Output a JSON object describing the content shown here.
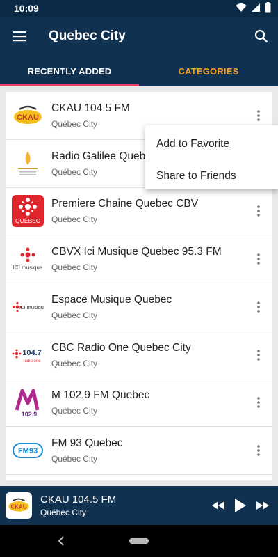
{
  "status_bar": {
    "time": "10:09",
    "icons": [
      "wifi-icon",
      "signal-icon",
      "battery-icon"
    ]
  },
  "app_bar": {
    "title": "Quebec City",
    "menu_icon": "hamburger-menu-icon",
    "search_icon": "search-icon"
  },
  "tabs": [
    {
      "label": "RECENTLY ADDED",
      "active": true
    },
    {
      "label": "CATEGORIES",
      "active": false
    }
  ],
  "stations": [
    {
      "name": "CKAU 104.5 FM",
      "city": "Québec City"
    },
    {
      "name": "Radio Galilee Quebec",
      "city": "Québec City"
    },
    {
      "name": "Premiere Chaine Quebec CBV",
      "city": "Québec City"
    },
    {
      "name": "CBVX Ici Musique Quebec 95.3 FM",
      "city": "Québec City"
    },
    {
      "name": "Espace Musique Quebec",
      "city": "Québec City"
    },
    {
      "name": "CBC Radio One Quebec City",
      "city": "Québec City"
    },
    {
      "name": "M 102.9 FM Quebec",
      "city": "Québec City"
    },
    {
      "name": "FM 93 Quebec",
      "city": "Québec City"
    }
  ],
  "logos": {
    "ckau": "CKAU",
    "premiere": "QUÉBEC",
    "ici_musique": "ICI musique",
    "cbc_freq": "104.7",
    "cbc_sub": "radio one",
    "m_freq": "102.9",
    "fm93": "FM93"
  },
  "popup_menu": {
    "items": [
      "Add to Favorite",
      "Share to Friends"
    ]
  },
  "player": {
    "station": "CKAU 104.5 FM",
    "city": "Québec City"
  },
  "colors": {
    "app_bar": "#103150",
    "tab_indicator": "#ea3f5f",
    "tab_inactive": "#f0a030"
  }
}
